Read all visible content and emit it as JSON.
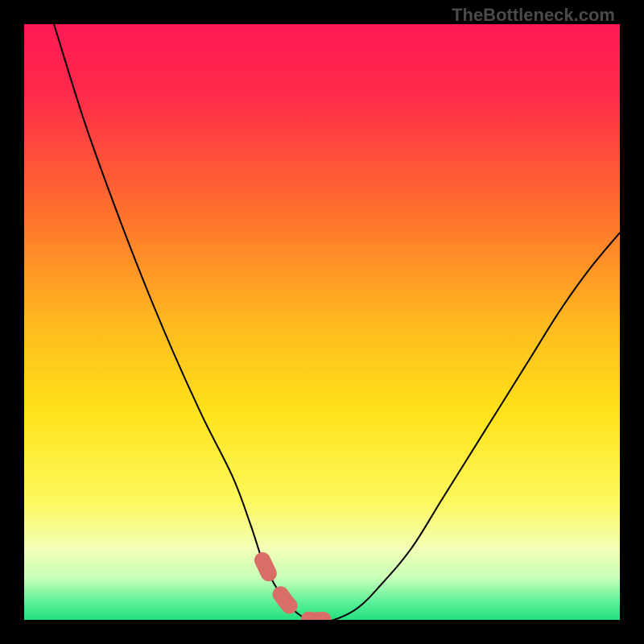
{
  "watermark": "TheBottleneck.com",
  "colors": {
    "frame": "#000000",
    "gradient_stops": [
      {
        "offset": 0.0,
        "color": "#ff1a55"
      },
      {
        "offset": 0.12,
        "color": "#ff2b4a"
      },
      {
        "offset": 0.3,
        "color": "#ff6a2f"
      },
      {
        "offset": 0.5,
        "color": "#ffb81f"
      },
      {
        "offset": 0.65,
        "color": "#ffe21a"
      },
      {
        "offset": 0.8,
        "color": "#fdf85c"
      },
      {
        "offset": 0.88,
        "color": "#f3ffb6"
      },
      {
        "offset": 0.93,
        "color": "#c8ffb8"
      },
      {
        "offset": 0.97,
        "color": "#5cf09a"
      },
      {
        "offset": 1.0,
        "color": "#23e07e"
      }
    ],
    "curve": "#000000",
    "marker_fill": "#d96e66",
    "marker_stroke": "#c85c55"
  },
  "chart_data": {
    "type": "line",
    "title": "",
    "xlabel": "",
    "ylabel": "",
    "xlim": [
      0,
      100
    ],
    "ylim": [
      0,
      100
    ],
    "grid": false,
    "legend": false,
    "annotations": [],
    "x": [
      5,
      10,
      15,
      20,
      25,
      30,
      35,
      38,
      40,
      42,
      44,
      46,
      48,
      50,
      52,
      56,
      60,
      65,
      70,
      75,
      80,
      85,
      90,
      95,
      100
    ],
    "values": [
      100,
      84,
      70,
      57,
      45,
      34,
      24,
      16,
      10,
      6,
      3,
      1,
      0,
      0,
      0,
      2,
      6,
      12,
      20,
      28,
      36,
      44,
      52,
      59,
      65
    ],
    "marker_segment": {
      "x": [
        40,
        42,
        44,
        46,
        48,
        50,
        52
      ],
      "values": [
        10,
        6,
        3,
        1,
        0,
        0,
        0
      ]
    }
  }
}
